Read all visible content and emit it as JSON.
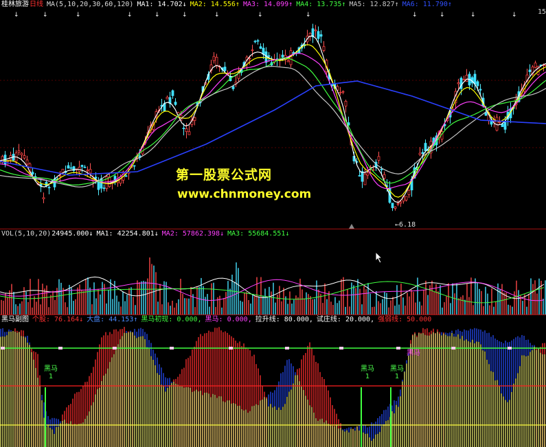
{
  "main_panel": {
    "stock_name": "桂林旅游",
    "period": "日线",
    "ma_param": "MA(5,10,20,30,60,120)",
    "ma": [
      {
        "label": "MA1: 14.702↓",
        "color": "#ffffff"
      },
      {
        "label": "MA2: 14.556↑",
        "color": "#ffff00"
      },
      {
        "label": "MA3: 14.099↑",
        "color": "#ff40ff"
      },
      {
        "label": "MA4: 13.735↑",
        "color": "#40ff40"
      },
      {
        "label": "MA5: 12.827↑",
        "color": "#c8c8c8"
      },
      {
        "label": "MA6: 11.790↑",
        "color": "#3050ff"
      }
    ],
    "right_price": "15",
    "low_label": "6.18"
  },
  "watermark": {
    "cn": "第一股票公式网",
    "url": "www.chnmoney.com"
  },
  "vol_panel": {
    "param": "VOL(5,10,20)",
    "value": "24945.000↓",
    "ma": [
      {
        "label": "MA1: 42254.801↓",
        "color": "#ffffff"
      },
      {
        "label": "MA2: 57862.398↓",
        "color": "#ff40ff"
      },
      {
        "label": "MA3: 55684.551↓",
        "color": "#40ff40"
      }
    ]
  },
  "indicator_panel": {
    "name": "黑马副图",
    "items": [
      {
        "label": "个股: 76.164↓",
        "color": "#ff3030"
      },
      {
        "label": "大盘: 44.153↑",
        "color": "#4a8cff"
      },
      {
        "label": "黑马初现: 0.000,",
        "color": "#40ff40"
      },
      {
        "label": "黑马: 0.000,",
        "color": "#ff40ff"
      },
      {
        "label": "拉升线: 80.000,",
        "color": "#ffffff"
      },
      {
        "label": "试庄线: 20.000,",
        "color": "#ffffff"
      },
      {
        "label": "强弱线: 50.000",
        "color": "#ff3030"
      }
    ],
    "markers": [
      {
        "text": "黑马",
        "sub": "1"
      },
      {
        "text": "黑马",
        "sub": "1"
      },
      {
        "text": "黑马",
        "sub": "1"
      },
      {
        "text": "黑马",
        "sub": "1"
      }
    ]
  }
}
